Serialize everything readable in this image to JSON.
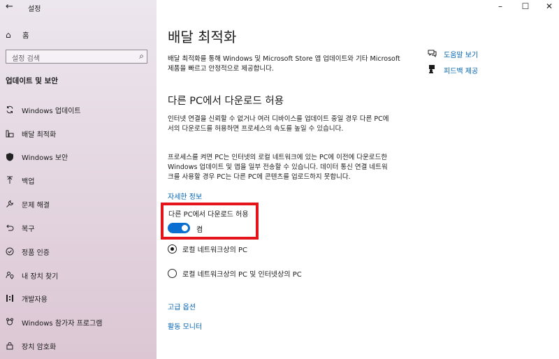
{
  "window": {
    "title": "설정",
    "back_icon": "arrow-left-icon",
    "controls": {
      "minimize": "–",
      "maximize": "☐",
      "close": "✕"
    }
  },
  "sidebar": {
    "home_label": "홈",
    "search_placeholder": "설정 검색",
    "section_title": "업데이트 및 보안",
    "items": [
      {
        "label": "Windows 업데이트",
        "icon": "sync-icon"
      },
      {
        "label": "배달 최적화",
        "icon": "delivery-icon"
      },
      {
        "label": "Windows 보안",
        "icon": "shield-icon"
      },
      {
        "label": "백업",
        "icon": "backup-icon"
      },
      {
        "label": "문제 해결",
        "icon": "wrench-icon"
      },
      {
        "label": "복구",
        "icon": "recovery-icon"
      },
      {
        "label": "정품 인증",
        "icon": "check-circle-icon"
      },
      {
        "label": "내 장치 찾기",
        "icon": "person-location-icon"
      },
      {
        "label": "개발자용",
        "icon": "developer-icon"
      },
      {
        "label": "Windows 참가자 프로그램",
        "icon": "insider-icon"
      },
      {
        "label": "장치 암호화",
        "icon": "lock-icon"
      }
    ]
  },
  "main": {
    "title": "배달 최적화",
    "intro": "배달 최적화를 통해 Windows 및 Microsoft Store 앱 업데이트와 기타 Microsoft 제품을 빠르고 안정적으로 제공합니다.",
    "side_links": {
      "help": "도움말 보기",
      "feedback": "피드백 제공"
    },
    "section_title": "다른 PC에서 다운로드 허용",
    "paragraph1": "인터넷 연결을 신뢰할 수 없거나 여러 디바이스를 업데이트 중일 경우 다른 PC에서의 다운로드를 허용하면 프로세스의 속도를 높일 수 있습니다.",
    "paragraph2": "프로세스를 켜면 PC는 인터넷의 로컬 네트워크에 있는 PC에 이전에 다운로드한 Windows 업데이트 및 앱을 일부 전송할 수 있습니다. 데이터 통신 연결 네트워크를 사용할 경우 PC는 다른 PC에 콘텐츠를 업로드하지 못합니다.",
    "more_info": "자세한 정보",
    "toggle": {
      "label": "다른 PC에서 다운로드 허용",
      "state": "켬",
      "on": true
    },
    "radio_local": "로컬 네트워크상의 PC",
    "radio_internet": "로컬 네트워크상의 PC 및 인터넷상의 PC",
    "advanced": "고급 옵션",
    "activity": "활동 모니터"
  },
  "colors": {
    "accent": "#0a6fd0",
    "link": "#0063b1",
    "highlight": "#e3141a"
  }
}
